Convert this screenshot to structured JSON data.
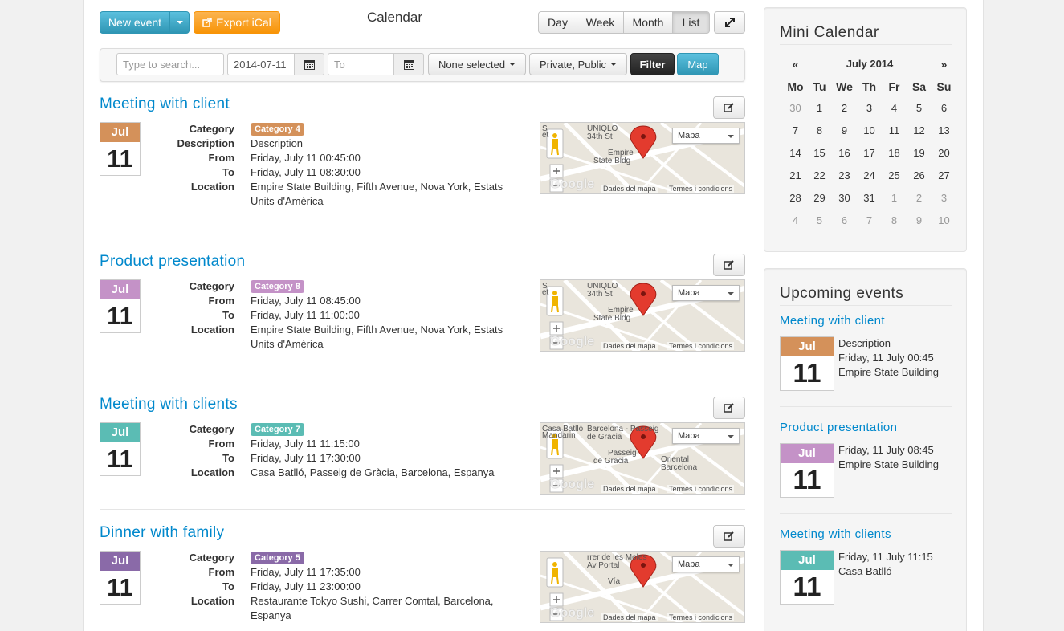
{
  "toolbar": {
    "new_event": "New event",
    "export": "Export iCal",
    "title": "Calendar",
    "views": [
      "Day",
      "Week",
      "Month",
      "List"
    ],
    "active_view": "List"
  },
  "filters": {
    "search_placeholder": "Type to search...",
    "from_date": "2014-07-11",
    "to_placeholder": "To",
    "category_select": "None selected",
    "privacy_select": "Private, Public",
    "filter_button": "Filter",
    "map_button": "Map"
  },
  "labels": {
    "category": "Category",
    "description": "Description",
    "from": "From",
    "to": "To",
    "location": "Location"
  },
  "map_labels": {
    "type": "Mapa",
    "data": "Dades del mapa",
    "terms": "Termes i condicions"
  },
  "events": [
    {
      "title": "Meeting with client",
      "month": "Jul",
      "day": "11",
      "color": "#d4915a",
      "category": "Category 4",
      "description": "Description",
      "from": "Friday, July 11 00:45:00",
      "to": "Friday, July 11 08:30:00",
      "location_line1": "Empire State Building, Fifth Avenue, Nova York, Estats",
      "location_line2": "Units d'Amèrica"
    },
    {
      "title": "Product presentation",
      "month": "Jul",
      "day": "11",
      "color": "#c492c7",
      "category": "Category 8",
      "from": "Friday, July 11 08:45:00",
      "to": "Friday, July 11 11:00:00",
      "location_line1": "Empire State Building, Fifth Avenue, Nova York, Estats",
      "location_line2": "Units d'Amèrica"
    },
    {
      "title": "Meeting with clients",
      "month": "Jul",
      "day": "11",
      "color": "#5bbcb4",
      "category": "Category 7",
      "from": "Friday, July 11 11:15:00",
      "to": "Friday, July 11 17:30:00",
      "location_line1": "Casa Batlló, Passeig de Gràcia, Barcelona, Espanya"
    },
    {
      "title": "Dinner with family",
      "month": "Jul",
      "day": "11",
      "color": "#8a6aa8",
      "category": "Category 5",
      "from": "Friday, July 11 17:35:00",
      "to": "Friday, July 11 23:00:00",
      "location_line1": "Restaurante Tokyo Sushi, Carrer Comtal, Barcelona,",
      "location_line2": "Espanya"
    }
  ],
  "maps": [
    {
      "labels": [
        "UNIQLO",
        "34th St",
        "Empire",
        "State Bldg",
        "S",
        "et"
      ]
    },
    {
      "labels": [
        "UNIQLO",
        "34th St",
        "Empire",
        "State Bldg",
        "S",
        "et"
      ]
    },
    {
      "labels": [
        "Barcelona - Passeig",
        "de Gracia",
        "Passeig",
        "de Gracia",
        "Casa Batlló",
        "Mandarin",
        "Oriental",
        "Barcelona"
      ]
    },
    {
      "labels": [
        "rrer de les Moles",
        "Av Portal",
        "Vía"
      ]
    }
  ],
  "mini_calendar": {
    "title": "Mini Calendar",
    "prev": "«",
    "next": "»",
    "month": "July 2014",
    "weekdays": [
      "Mo",
      "Tu",
      "We",
      "Th",
      "Fr",
      "Sa",
      "Su"
    ],
    "weeks": [
      [
        "30",
        "1",
        "2",
        "3",
        "4",
        "5",
        "6"
      ],
      [
        "7",
        "8",
        "9",
        "10",
        "11",
        "12",
        "13"
      ],
      [
        "14",
        "15",
        "16",
        "17",
        "18",
        "19",
        "20"
      ],
      [
        "21",
        "22",
        "23",
        "24",
        "25",
        "26",
        "27"
      ],
      [
        "28",
        "29",
        "30",
        "31",
        "1",
        "2",
        "3"
      ],
      [
        "4",
        "5",
        "6",
        "7",
        "8",
        "9",
        "10"
      ]
    ]
  },
  "upcoming": {
    "title": "Upcoming events",
    "items": [
      {
        "title": "Meeting with client",
        "month": "Jul",
        "day": "11",
        "color": "#d4915a",
        "line1": "Description",
        "line2": "Friday, 11 July 00:45",
        "line3": "Empire State Building"
      },
      {
        "title": "Product presentation",
        "month": "Jul",
        "day": "11",
        "color": "#c492c7",
        "line1": "Friday, 11 July 08:45",
        "line2": "Empire State Building"
      },
      {
        "title": "Meeting with clients",
        "month": "Jul",
        "day": "11",
        "color": "#5bbcb4",
        "line1": "Friday, 11 July 11:15",
        "line2": "Casa Batlló"
      }
    ]
  }
}
